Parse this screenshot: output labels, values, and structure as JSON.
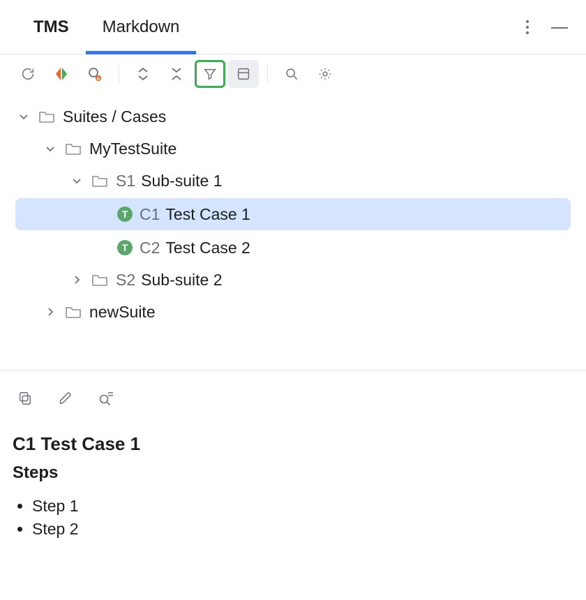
{
  "tabs": {
    "tms": {
      "label": "TMS"
    },
    "markdown": {
      "label": "Markdown"
    }
  },
  "tree": {
    "root": {
      "label": "Suites / Cases"
    },
    "suite1": {
      "label": "MyTestSuite"
    },
    "sub1": {
      "id": "S1",
      "label": "Sub-suite 1"
    },
    "tc1": {
      "id": "C1",
      "label": "Test Case 1",
      "badge": "T"
    },
    "tc2": {
      "id": "C2",
      "label": "Test Case 2",
      "badge": "T"
    },
    "sub2": {
      "id": "S2",
      "label": "Sub-suite 2"
    },
    "suite2": {
      "label": "newSuite"
    }
  },
  "detail": {
    "title": "C1 Test Case 1",
    "steps_heading": "Steps",
    "steps": {
      "s1": "Step 1",
      "s2": "Step 2"
    }
  }
}
